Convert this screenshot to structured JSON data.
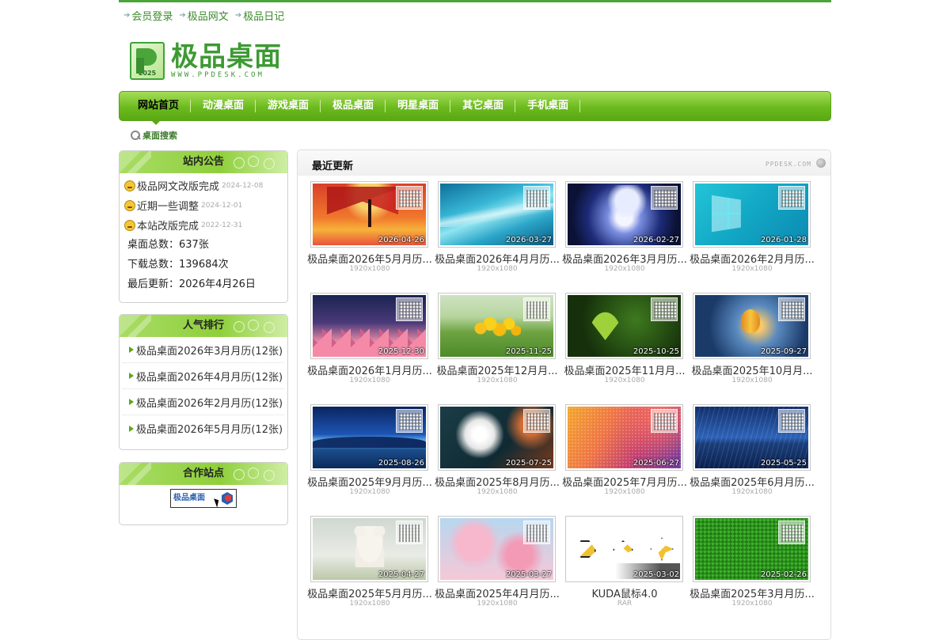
{
  "top_links": [
    "会员登录",
    "极品网文",
    "极品日记"
  ],
  "logo": {
    "title": "极品桌面",
    "url": "WWW.PPDESK.COM",
    "year": "2025"
  },
  "nav": {
    "items": [
      "网站首页",
      "动漫桌面",
      "游戏桌面",
      "极品桌面",
      "明星桌面",
      "其它桌面",
      "手机桌面"
    ],
    "active": "网站首页"
  },
  "search_link": "桌面搜索",
  "announcements": {
    "title": "站内公告",
    "items": [
      {
        "text": "极品网文改版完成",
        "date": "2024-12-08"
      },
      {
        "text": "近期一些调整",
        "date": "2024-12-01"
      },
      {
        "text": "本站改版完成",
        "date": "2022-12-31"
      }
    ],
    "stats": [
      "桌面总数：637张",
      "下载总数：139684次",
      "最后更新：2026年4月26日"
    ]
  },
  "ranking": {
    "title": "人气排行",
    "items": [
      "极品桌面2026年3月月历(12张)",
      "极品桌面2026年4月月历(12张)",
      "极品桌面2026年2月月历(12张)",
      "极品桌面2026年5月月历(12张)"
    ]
  },
  "partners": {
    "title": "合作站点",
    "logo_text": "极品桌面"
  },
  "main": {
    "title": "最近更新",
    "brand": "PPDESK.COM",
    "cards": [
      {
        "title": "极品桌面2026年5月月历...",
        "sub": "1920x1080",
        "date": "2026-04-26",
        "art": "art-phoenix"
      },
      {
        "title": "极品桌面2026年4月月历...",
        "sub": "1920x1080",
        "date": "2026-03-27",
        "art": "art-wave"
      },
      {
        "title": "极品桌面2026年3月月历...",
        "sub": "1920x1080",
        "date": "2026-02-27",
        "art": "art-goku"
      },
      {
        "title": "极品桌面2026年2月月历...",
        "sub": "1920x1080",
        "date": "2026-01-28",
        "art": "art-win"
      },
      {
        "title": "极品桌面2026年1月月历...",
        "sub": "1920x1080",
        "date": "2025-12-30",
        "art": "art-mountain"
      },
      {
        "title": "极品桌面2025年12月月...",
        "sub": "1920x1080",
        "date": "2025-11-25",
        "art": "art-dandelion-y"
      },
      {
        "title": "极品桌面2025年11月月...",
        "sub": "1920x1080",
        "date": "2025-10-25",
        "art": "art-ginkgo"
      },
      {
        "title": "极品桌面2025年10月月...",
        "sub": "1920x1080",
        "date": "2025-09-27",
        "art": "art-balloon"
      },
      {
        "title": "极品桌面2025年9月月历...",
        "sub": "1920x1080",
        "date": "2025-08-26",
        "art": "art-night-lake"
      },
      {
        "title": "极品桌面2025年8月月历...",
        "sub": "1920x1080",
        "date": "2025-07-25",
        "art": "art-dandelion-w"
      },
      {
        "title": "极品桌面2025年7月月历...",
        "sub": "1920x1080",
        "date": "2025-06-27",
        "art": "art-gradient"
      },
      {
        "title": "极品桌面2025年6月月历...",
        "sub": "1920x1080",
        "date": "2025-05-25",
        "art": "art-starlake"
      },
      {
        "title": "极品桌面2025年5月月历...",
        "sub": "1920x1080",
        "date": "2025-04-27",
        "art": "art-bear"
      },
      {
        "title": "极品桌面2025年4月月历...",
        "sub": "1920x1080",
        "date": "2025-03-27",
        "art": "art-sakura"
      },
      {
        "title": "KUDA鼠标4.0",
        "sub": "RAR",
        "date": "2025-03-02",
        "art": "art-kuda"
      },
      {
        "title": "极品桌面2025年3月月历...",
        "sub": "1920x1080",
        "date": "2025-02-26",
        "art": "art-grass"
      }
    ]
  },
  "colors": {
    "accent": "#5aa812",
    "link": "#3b8a2b",
    "top_border": "#4aa53a"
  }
}
